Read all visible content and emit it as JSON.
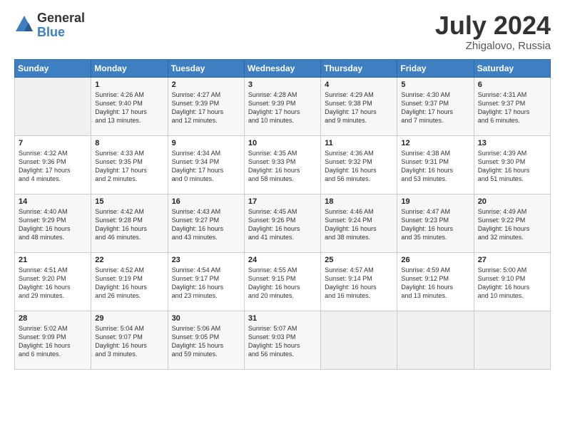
{
  "logo": {
    "general": "General",
    "blue": "Blue"
  },
  "title": "July 2024",
  "subtitle": "Zhigalovo, Russia",
  "days_of_week": [
    "Sunday",
    "Monday",
    "Tuesday",
    "Wednesday",
    "Thursday",
    "Friday",
    "Saturday"
  ],
  "weeks": [
    [
      {
        "day": "",
        "info": ""
      },
      {
        "day": "1",
        "info": "Sunrise: 4:26 AM\nSunset: 9:40 PM\nDaylight: 17 hours\nand 13 minutes."
      },
      {
        "day": "2",
        "info": "Sunrise: 4:27 AM\nSunset: 9:39 PM\nDaylight: 17 hours\nand 12 minutes."
      },
      {
        "day": "3",
        "info": "Sunrise: 4:28 AM\nSunset: 9:39 PM\nDaylight: 17 hours\nand 10 minutes."
      },
      {
        "day": "4",
        "info": "Sunrise: 4:29 AM\nSunset: 9:38 PM\nDaylight: 17 hours\nand 9 minutes."
      },
      {
        "day": "5",
        "info": "Sunrise: 4:30 AM\nSunset: 9:37 PM\nDaylight: 17 hours\nand 7 minutes."
      },
      {
        "day": "6",
        "info": "Sunrise: 4:31 AM\nSunset: 9:37 PM\nDaylight: 17 hours\nand 6 minutes."
      }
    ],
    [
      {
        "day": "7",
        "info": "Sunrise: 4:32 AM\nSunset: 9:36 PM\nDaylight: 17 hours\nand 4 minutes."
      },
      {
        "day": "8",
        "info": "Sunrise: 4:33 AM\nSunset: 9:35 PM\nDaylight: 17 hours\nand 2 minutes."
      },
      {
        "day": "9",
        "info": "Sunrise: 4:34 AM\nSunset: 9:34 PM\nDaylight: 17 hours\nand 0 minutes."
      },
      {
        "day": "10",
        "info": "Sunrise: 4:35 AM\nSunset: 9:33 PM\nDaylight: 16 hours\nand 58 minutes."
      },
      {
        "day": "11",
        "info": "Sunrise: 4:36 AM\nSunset: 9:32 PM\nDaylight: 16 hours\nand 56 minutes."
      },
      {
        "day": "12",
        "info": "Sunrise: 4:38 AM\nSunset: 9:31 PM\nDaylight: 16 hours\nand 53 minutes."
      },
      {
        "day": "13",
        "info": "Sunrise: 4:39 AM\nSunset: 9:30 PM\nDaylight: 16 hours\nand 51 minutes."
      }
    ],
    [
      {
        "day": "14",
        "info": "Sunrise: 4:40 AM\nSunset: 9:29 PM\nDaylight: 16 hours\nand 48 minutes."
      },
      {
        "day": "15",
        "info": "Sunrise: 4:42 AM\nSunset: 9:28 PM\nDaylight: 16 hours\nand 46 minutes."
      },
      {
        "day": "16",
        "info": "Sunrise: 4:43 AM\nSunset: 9:27 PM\nDaylight: 16 hours\nand 43 minutes."
      },
      {
        "day": "17",
        "info": "Sunrise: 4:45 AM\nSunset: 9:26 PM\nDaylight: 16 hours\nand 41 minutes."
      },
      {
        "day": "18",
        "info": "Sunrise: 4:46 AM\nSunset: 9:24 PM\nDaylight: 16 hours\nand 38 minutes."
      },
      {
        "day": "19",
        "info": "Sunrise: 4:47 AM\nSunset: 9:23 PM\nDaylight: 16 hours\nand 35 minutes."
      },
      {
        "day": "20",
        "info": "Sunrise: 4:49 AM\nSunset: 9:22 PM\nDaylight: 16 hours\nand 32 minutes."
      }
    ],
    [
      {
        "day": "21",
        "info": "Sunrise: 4:51 AM\nSunset: 9:20 PM\nDaylight: 16 hours\nand 29 minutes."
      },
      {
        "day": "22",
        "info": "Sunrise: 4:52 AM\nSunset: 9:19 PM\nDaylight: 16 hours\nand 26 minutes."
      },
      {
        "day": "23",
        "info": "Sunrise: 4:54 AM\nSunset: 9:17 PM\nDaylight: 16 hours\nand 23 minutes."
      },
      {
        "day": "24",
        "info": "Sunrise: 4:55 AM\nSunset: 9:15 PM\nDaylight: 16 hours\nand 20 minutes."
      },
      {
        "day": "25",
        "info": "Sunrise: 4:57 AM\nSunset: 9:14 PM\nDaylight: 16 hours\nand 16 minutes."
      },
      {
        "day": "26",
        "info": "Sunrise: 4:59 AM\nSunset: 9:12 PM\nDaylight: 16 hours\nand 13 minutes."
      },
      {
        "day": "27",
        "info": "Sunrise: 5:00 AM\nSunset: 9:10 PM\nDaylight: 16 hours\nand 10 minutes."
      }
    ],
    [
      {
        "day": "28",
        "info": "Sunrise: 5:02 AM\nSunset: 9:09 PM\nDaylight: 16 hours\nand 6 minutes."
      },
      {
        "day": "29",
        "info": "Sunrise: 5:04 AM\nSunset: 9:07 PM\nDaylight: 16 hours\nand 3 minutes."
      },
      {
        "day": "30",
        "info": "Sunrise: 5:06 AM\nSunset: 9:05 PM\nDaylight: 15 hours\nand 59 minutes."
      },
      {
        "day": "31",
        "info": "Sunrise: 5:07 AM\nSunset: 9:03 PM\nDaylight: 15 hours\nand 56 minutes."
      },
      {
        "day": "",
        "info": ""
      },
      {
        "day": "",
        "info": ""
      },
      {
        "day": "",
        "info": ""
      }
    ]
  ]
}
